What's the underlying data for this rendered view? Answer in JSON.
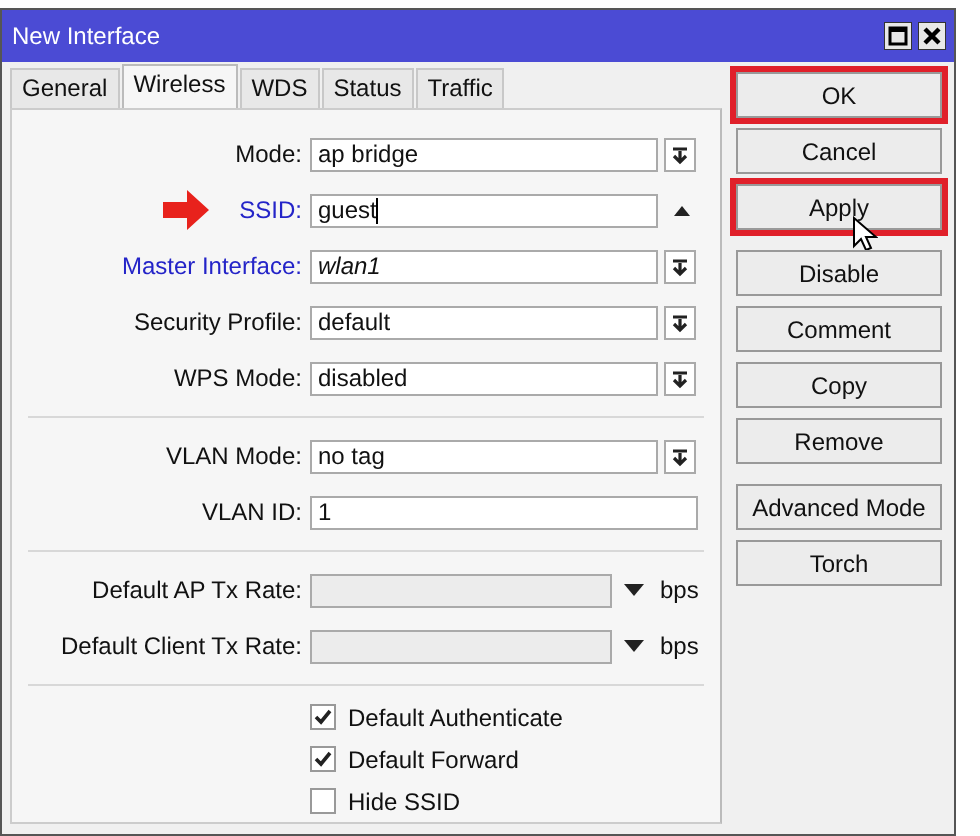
{
  "window": {
    "title": "New Interface"
  },
  "tabs": [
    {
      "label": "General",
      "selected": false
    },
    {
      "label": "Wireless",
      "selected": true
    },
    {
      "label": "WDS",
      "selected": false
    },
    {
      "label": "Status",
      "selected": false
    },
    {
      "label": "Traffic",
      "selected": false
    }
  ],
  "sections": [
    {
      "fields": [
        {
          "kind": "select",
          "label": "Mode:",
          "value": "ap bridge",
          "linked": false,
          "pointed": false
        },
        {
          "kind": "text-up",
          "label": "SSID:",
          "value": "guest",
          "linked": true,
          "pointed": true
        },
        {
          "kind": "select",
          "label": "Master Interface:",
          "value": "wlan1",
          "linked": true,
          "pointed": false
        },
        {
          "kind": "select",
          "label": "Security Profile:",
          "value": "default",
          "linked": false,
          "pointed": false
        },
        {
          "kind": "select",
          "label": "WPS Mode:",
          "value": "disabled",
          "linked": false,
          "pointed": false
        }
      ]
    },
    {
      "fields": [
        {
          "kind": "select",
          "label": "VLAN Mode:",
          "value": "no tag",
          "linked": false,
          "pointed": false
        },
        {
          "kind": "text",
          "label": "VLAN ID:",
          "value": "1",
          "linked": false,
          "pointed": false
        }
      ]
    },
    {
      "fields": [
        {
          "kind": "rate",
          "label": "Default AP Tx Rate:",
          "unit": "bps",
          "linked": false,
          "pointed": false
        },
        {
          "kind": "rate",
          "label": "Default Client Tx Rate:",
          "unit": "bps",
          "linked": false,
          "pointed": false
        }
      ]
    },
    {
      "fields": [
        {
          "kind": "checkbox",
          "label": "Default Authenticate",
          "checked": true
        },
        {
          "kind": "checkbox",
          "label": "Default Forward",
          "checked": true
        },
        {
          "kind": "checkbox",
          "label": "Hide SSID",
          "checked": false
        }
      ]
    }
  ],
  "button_groups": [
    {
      "buttons": [
        {
          "label": "OK",
          "outlined": true,
          "cursor": false
        },
        {
          "label": "Cancel",
          "outlined": false,
          "cursor": false
        },
        {
          "label": "Apply",
          "outlined": true,
          "cursor": true
        }
      ]
    },
    {
      "buttons": [
        {
          "label": "Disable",
          "outlined": false,
          "cursor": false
        },
        {
          "label": "Comment",
          "outlined": false,
          "cursor": false
        },
        {
          "label": "Copy",
          "outlined": false,
          "cursor": false
        },
        {
          "label": "Remove",
          "outlined": false,
          "cursor": false
        }
      ]
    },
    {
      "buttons": [
        {
          "label": "Advanced Mode",
          "outlined": false,
          "cursor": false
        },
        {
          "label": "Torch",
          "outlined": false,
          "cursor": false
        }
      ]
    }
  ]
}
